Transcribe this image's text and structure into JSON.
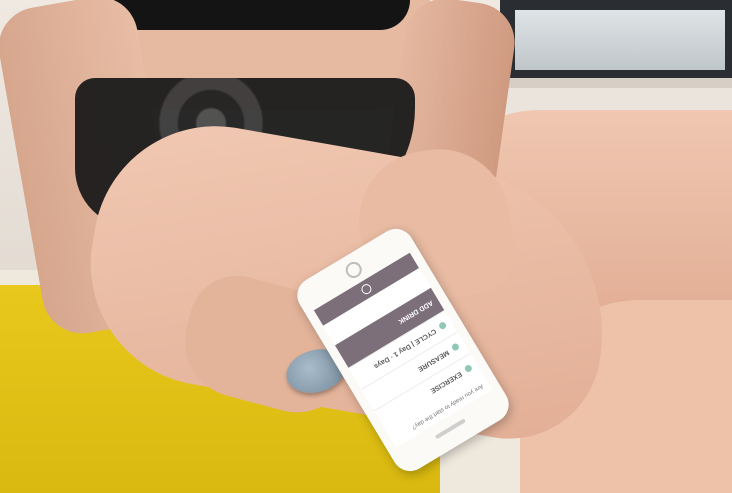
{
  "scene": {
    "palette": {
      "mat": "#e0c218",
      "skin": "#e8bca4",
      "phone_accent": "#7c6f7a",
      "sensor": "#8fa3b4"
    }
  },
  "phone_app": {
    "header_text": "Are you ready to start the day?",
    "items": [
      {
        "label": "EXERCISE",
        "icon": "running-icon"
      },
      {
        "label": "MEASURE",
        "icon": "pulse-icon"
      },
      {
        "label": "CYCLE | Day 1 · Days",
        "icon": "cycle-icon"
      }
    ],
    "add_button": "ADD DRINK"
  }
}
